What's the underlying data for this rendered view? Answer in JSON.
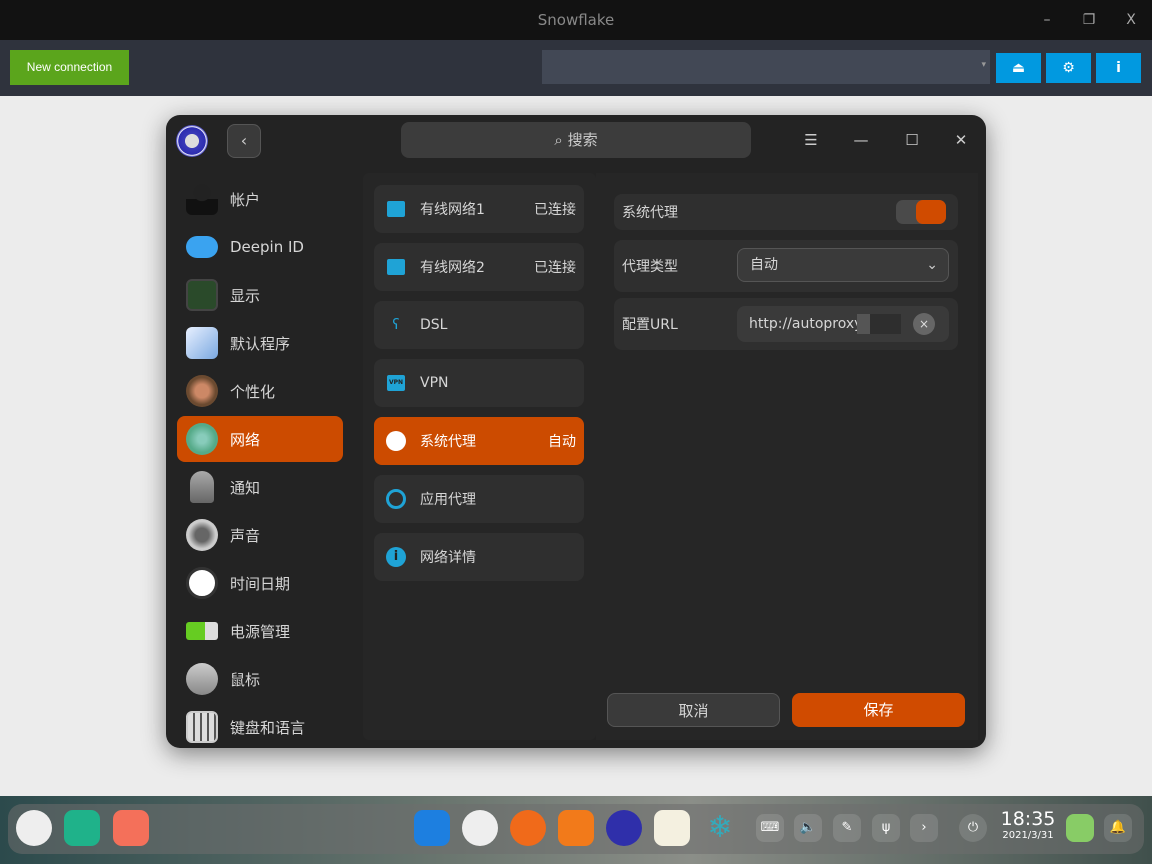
{
  "window": {
    "title": "Snowflake",
    "minimize": "–",
    "restore": "❐",
    "close": "X"
  },
  "toolbar": {
    "new_connection": "New connection",
    "combo_arrow": "▾",
    "eject": "⏏",
    "settings": "⚙",
    "info": "i"
  },
  "dialog": {
    "search_placeholder": "搜索",
    "back": "‹",
    "menu": "☰",
    "minimize": "—",
    "maximize": "☐",
    "close": "✕",
    "sidebar": [
      {
        "label": "帐户"
      },
      {
        "label": "Deepin ID"
      },
      {
        "label": "显示"
      },
      {
        "label": "默认程序"
      },
      {
        "label": "个性化"
      },
      {
        "label": "网络"
      },
      {
        "label": "通知"
      },
      {
        "label": "声音"
      },
      {
        "label": "时间日期"
      },
      {
        "label": "电源管理"
      },
      {
        "label": "鼠标"
      },
      {
        "label": "键盘和语言"
      }
    ],
    "network_items": [
      {
        "label": "有线网络1",
        "status": "已连接"
      },
      {
        "label": "有线网络2",
        "status": "已连接"
      },
      {
        "label": "DSL",
        "status": ""
      },
      {
        "label": "VPN",
        "status": ""
      },
      {
        "label": "系统代理",
        "status": "自动"
      },
      {
        "label": "应用代理",
        "status": ""
      },
      {
        "label": "网络详情",
        "status": ""
      }
    ],
    "proxy": {
      "system_proxy_label": "系统代理",
      "system_proxy_on": true,
      "type_label": "代理类型",
      "type_value": "自动",
      "url_label": "配置URL",
      "url_value": "http://autoproxy.",
      "clear": "×"
    },
    "cancel": "取消",
    "save": "保存",
    "accent": "#cc4b00"
  },
  "taskbar": {
    "time": "18:35",
    "date": "2021/3/31",
    "more": "›"
  }
}
